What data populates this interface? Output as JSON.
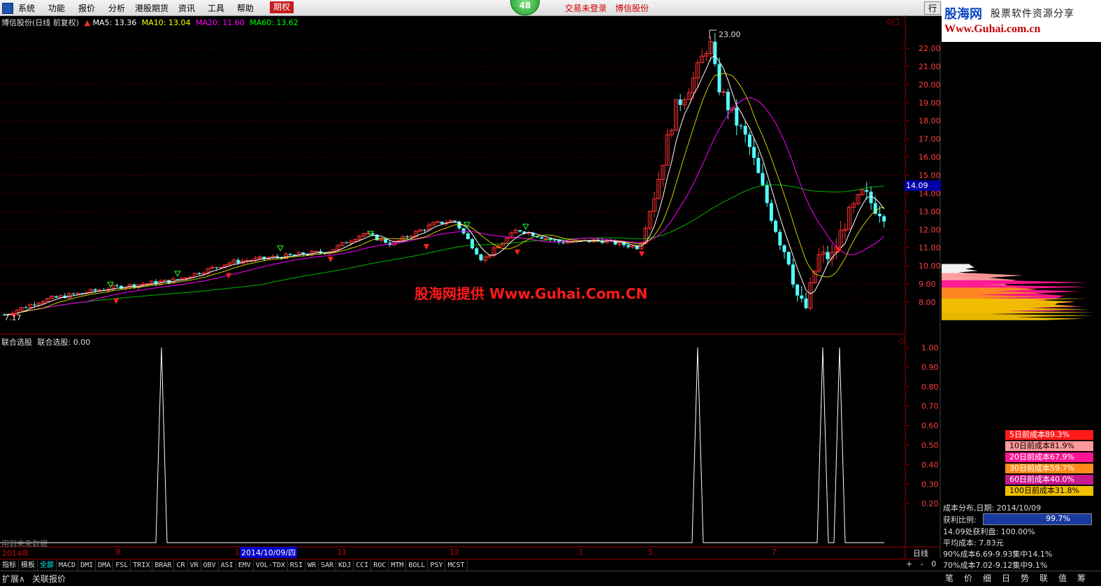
{
  "menubar": {
    "items": [
      "系统",
      "功能",
      "报价",
      "分析",
      "港股期货",
      "资讯",
      "工具",
      "帮助"
    ],
    "active_item": "期权",
    "badge": "48",
    "login_status": "交易未登录",
    "broker": "博信股份",
    "right_button": "行"
  },
  "banner": {
    "brand": "股海网",
    "tagline": "股票软件资源分享",
    "url": "Www.Guhai.com.cn"
  },
  "main_chart": {
    "title": "博信股份(日线 前复权)",
    "ma5": "MA5: 13.36",
    "ma10": "MA10: 13.04",
    "ma20": "MA20: 11.60",
    "ma60": "MA60: 13.62",
    "high_label": "23.00",
    "low_label": "7.17",
    "current_price": "14.09",
    "watermark": "股海网提供 Www.Guhai.Com.CN",
    "y_ticks": [
      "22.00",
      "21.00",
      "20.00",
      "19.00",
      "18.00",
      "17.00",
      "16.00",
      "15.00",
      "14.00",
      "13.00",
      "12.00",
      "11.00",
      "10.00",
      "9.00",
      "8.00"
    ]
  },
  "indicator": {
    "title": "联合选股",
    "value_label": "联合选股: 0.00",
    "y_ticks": [
      "1.00",
      "0.90",
      "0.80",
      "0.70",
      "0.60",
      "0.50",
      "0.40",
      "0.30",
      "0.20"
    ],
    "footer_note": "用到未来数据"
  },
  "x_axis": {
    "labels": [
      "2014年",
      "9",
      "1",
      "11",
      "12",
      "1",
      "5",
      "7"
    ],
    "cursor_date": "2014/10/09/四",
    "period": "日线"
  },
  "tabs": {
    "items": [
      "指标",
      "模板",
      "全部",
      "MACD",
      "DMI",
      "DMA",
      "FSL",
      "TRIX",
      "BRAR",
      "CR",
      "VR",
      "OBV",
      "ASI",
      "EMV",
      "VOL-TDX",
      "RSI",
      "WR",
      "SAR",
      "KDJ",
      "CCI",
      "ROC",
      "MTM",
      "BOLL",
      "PSY",
      "MCST"
    ],
    "selected": "全部",
    "right_controls": [
      "+",
      "-",
      "0"
    ]
  },
  "bottombar": {
    "left": [
      "扩展∧",
      "关联报价"
    ],
    "right_tabs": [
      "笔",
      "价",
      "细",
      "日",
      "势",
      "联",
      "值",
      "筹"
    ]
  },
  "cost_panel": {
    "bars": [
      {
        "label": "5日前成本89.3%",
        "color": "#ff1a1a"
      },
      {
        "label": "10日前成本81.9%",
        "color": "#ff9a9a"
      },
      {
        "label": "20日前成本67.9%",
        "color": "#ff1493"
      },
      {
        "label": "30日前成本59.7%",
        "color": "#ff8c1a"
      },
      {
        "label": "60日前成本40.0%",
        "color": "#c8188c"
      },
      {
        "label": "100日前成本31.8%",
        "color": "#f0c000"
      }
    ],
    "date_line": "成本分布,日期: 2014/10/09",
    "profit_label": "获利比例:",
    "profit_value": "99.7%",
    "profit_fraction": 0.997,
    "line1": "14.09处获利盘: 100.00%",
    "line2": "平均成本: 7.83元",
    "line3": "90%成本6.69-9.93集中14.1%",
    "line4": "70%成本7.02-9.12集中9.1%"
  },
  "colors": {
    "up": "#ff3232",
    "down": "#54ffff",
    "ma5": "#ffffff",
    "ma10": "#ffff00",
    "ma20": "#ff00ff",
    "ma60": "#00ff00",
    "grid": "#800000"
  }
}
